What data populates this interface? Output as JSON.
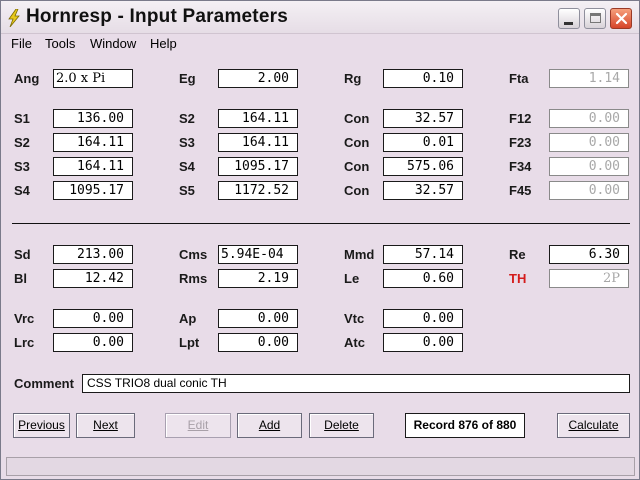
{
  "window": {
    "title": "Hornresp - Input Parameters"
  },
  "menu": [
    "File",
    "Tools",
    "Window",
    "Help"
  ],
  "params": {
    "ang": {
      "label": "Ang",
      "value": "2.0 x Pi"
    },
    "eg": {
      "label": "Eg",
      "value": "2.00"
    },
    "rg": {
      "label": "Rg",
      "value": "0.10"
    },
    "fta": {
      "label": "Fta",
      "value": "1.14"
    },
    "s1": {
      "label": "S1",
      "value": "136.00"
    },
    "s2a": {
      "label": "S2",
      "value": "164.11"
    },
    "con1": {
      "label": "Con",
      "value": "32.57"
    },
    "f12": {
      "label": "F12",
      "value": "0.00"
    },
    "s2b": {
      "label": "S2",
      "value": "164.11"
    },
    "s3a": {
      "label": "S3",
      "value": "164.11"
    },
    "con2": {
      "label": "Con",
      "value": "0.01"
    },
    "f23": {
      "label": "F23",
      "value": "0.00"
    },
    "s3b": {
      "label": "S3",
      "value": "164.11"
    },
    "s4a": {
      "label": "S4",
      "value": "1095.17"
    },
    "con3": {
      "label": "Con",
      "value": "575.06"
    },
    "f34": {
      "label": "F34",
      "value": "0.00"
    },
    "s4b": {
      "label": "S4",
      "value": "1095.17"
    },
    "s5": {
      "label": "S5",
      "value": "1172.52"
    },
    "con4": {
      "label": "Con",
      "value": "32.57"
    },
    "f45": {
      "label": "F45",
      "value": "0.00"
    }
  },
  "driver": {
    "sd": {
      "label": "Sd",
      "value": "213.00"
    },
    "cms": {
      "label": "Cms",
      "value": "5.94E-04"
    },
    "mmd": {
      "label": "Mmd",
      "value": "57.14"
    },
    "re": {
      "label": "Re",
      "value": "6.30"
    },
    "bl": {
      "label": "Bl",
      "value": "12.42"
    },
    "rms": {
      "label": "Rms",
      "value": "2.19"
    },
    "le": {
      "label": "Le",
      "value": "0.60"
    },
    "th": {
      "label": "TH",
      "value": "2P"
    }
  },
  "chamber": {
    "vrc": {
      "label": "Vrc",
      "value": "0.00"
    },
    "ap": {
      "label": "Ap",
      "value": "0.00"
    },
    "vtc": {
      "label": "Vtc",
      "value": "0.00"
    },
    "lrc": {
      "label": "Lrc",
      "value": "0.00"
    },
    "lpt": {
      "label": "Lpt",
      "value": "0.00"
    },
    "atc": {
      "label": "Atc",
      "value": "0.00"
    }
  },
  "comment": {
    "label": "Comment",
    "value": "CSS TRIO8 dual conic TH"
  },
  "buttons": {
    "previous": "Previous",
    "next": "Next",
    "edit": "Edit",
    "add": "Add",
    "delete": "Delete",
    "calculate": "Calculate"
  },
  "record": "Record 876 of 880",
  "colors": {
    "background": "#e8dce8",
    "th_label": "#d41c1c",
    "close_button": "#d6452a"
  }
}
